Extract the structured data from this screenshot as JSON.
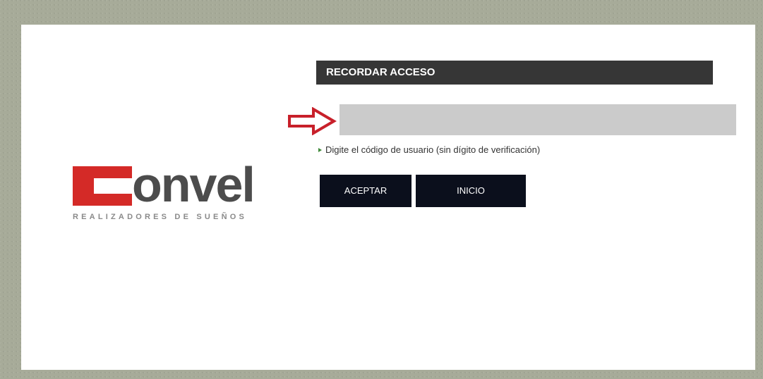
{
  "logo": {
    "name": "Convel",
    "rest": "onvel",
    "tagline": "REALIZADORES DE SUEÑOS"
  },
  "form": {
    "title": "RECORDAR ACCESO",
    "code_value": "",
    "code_placeholder": "",
    "hint": "Digite el código de usuario (sin dígito de verificación)"
  },
  "buttons": {
    "accept": "ACEPTAR",
    "home": "INICIO"
  },
  "colors": {
    "brand_red": "#d42a27",
    "header_bar": "#363636",
    "button": "#0b0f1c",
    "input_bg": "#cbcbcb",
    "arrow": "#c8202a"
  },
  "icons": {
    "arrow": "red-outline-right-arrow-icon",
    "hint_bullet": "green-triangle-bullet-icon"
  }
}
